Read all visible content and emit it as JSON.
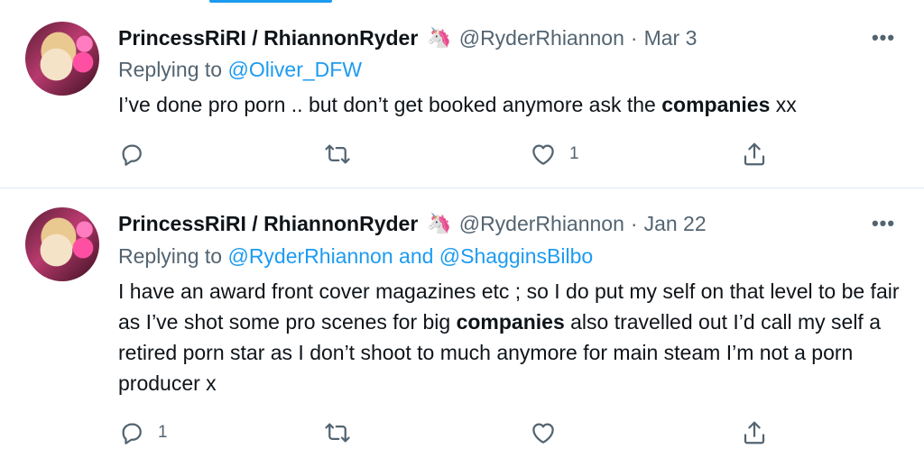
{
  "tweets": [
    {
      "display_name": "PrincessRiRI / RhiannonRyder",
      "emoji": "🦄",
      "handle": "@RyderRhiannon",
      "separator": "·",
      "date": "Mar 3",
      "more_label": "•••",
      "replying_prefix": "Replying to ",
      "replying_to_1": "@Oliver_DFW",
      "body_part1": "I’ve done pro porn .. but don’t get booked anymore ask the ",
      "body_bold1": "companies",
      "body_part2": " xx",
      "reply_count": "",
      "retweet_count": "",
      "like_count": "1",
      "icons": [
        "reply-icon",
        "retweet-icon",
        "like-icon",
        "share-icon"
      ]
    },
    {
      "display_name": "PrincessRiRI / RhiannonRyder",
      "emoji": "🦄",
      "handle": "@RyderRhiannon",
      "separator": "·",
      "date": "Jan 22",
      "more_label": "•••",
      "replying_prefix": "Replying to ",
      "replying_to_1": "@RyderRhiannon",
      "replying_joiner": " and ",
      "replying_to_2": "@ShagginsBilbo",
      "body_part1": "I have an award front cover magazines etc ; so I do put my self on that level to be fair as I’ve shot some pro scenes for big ",
      "body_bold1": "companies",
      "body_part2": " also travelled out I’d call my self a retired porn star as I don’t shoot to much anymore for main steam I’m not a porn producer x",
      "reply_count": "1",
      "retweet_count": "",
      "like_count": "",
      "icons": [
        "reply-icon",
        "retweet-icon",
        "like-icon",
        "share-icon"
      ]
    }
  ],
  "colors": {
    "link": "#1d9bf0",
    "secondary_text": "#536471",
    "primary_text": "#0f1419",
    "divider": "#e6ecf0"
  }
}
